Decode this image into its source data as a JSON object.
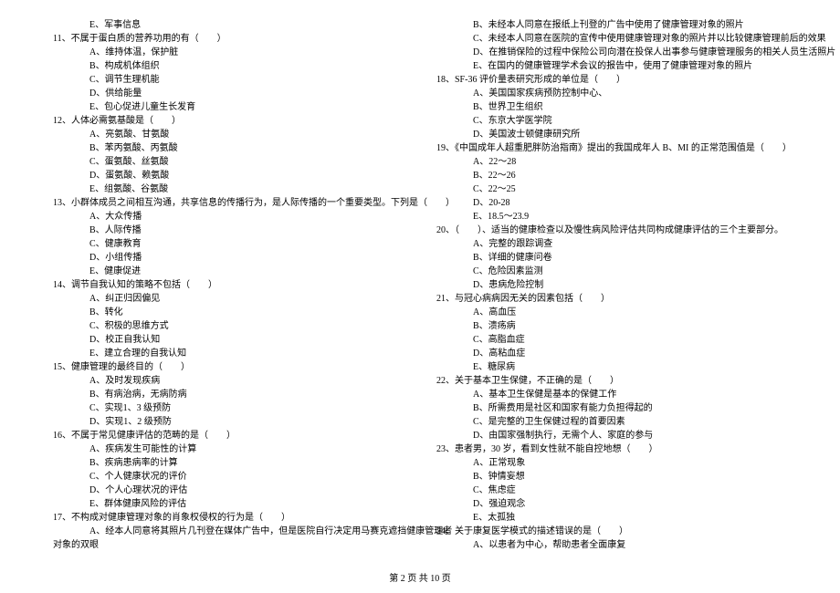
{
  "left": {
    "l1": "E、军事信息",
    "q11": "11、不属于蛋白质的营养功用的有（　　）",
    "q11a": "A、维持体温，保护脏",
    "q11b": "B、构成机体组织",
    "q11c": "C、调节生理机能",
    "q11d": "D、供给能量",
    "q11e": "E、包心促进儿童生长发育",
    "q12": "12、人体必需氨基酸是（　　）",
    "q12a": "A、亮氨酸、甘氨酸",
    "q12b": "B、苯丙氨酸、丙氨酸",
    "q12c": "C、蛋氨酸、丝氨酸",
    "q12d": "D、蛋氨酸、赖氨酸",
    "q12e": "E、组氨酸、谷氨酸",
    "q13": "13、小群体成员之间相互沟通，共享信息的传播行为，是人际传播的一个重要类型。下列是（　　）",
    "q13a": "A、大众传播",
    "q13b": "B、人际传播",
    "q13c": "C、健康教育",
    "q13d": "D、小组传播",
    "q13e": "E、健康促进",
    "q14": "14、调节自我认知的策略不包括（　　）",
    "q14a": "A、纠正归因偏见",
    "q14b": "B、转化",
    "q14c": "C、积极的思维方式",
    "q14d": "D、校正自我认知",
    "q14e": "E、建立合理的自我认知",
    "q15": "15、健康管理的最终目的（　　）",
    "q15a": "A、及时发现疾病",
    "q15b": "B、有病治病，无病防病",
    "q15c": "C、实现1、3 级预防",
    "q15d": "D、实现1、2 级预防",
    "q16": "16、不属于常见健康评估的范畴的是（　　）",
    "q16a": "A、疾病发生可能性的计算",
    "q16b": "B、疾病患病率的计算",
    "q16c": "C、个人健康状况的评价",
    "q16d": "D、个人心理状况的评估",
    "q16e": "E、群体健康风险的评估",
    "q17": "17、不构成对健康管理对象的肖象权侵权的行为是（　　）",
    "q17line1": "A、经本人同意将其照片几刊登在媒体广告中，但是医院自行决定用马赛克遮挡健康管理者",
    "q17line2": "对象的双眼"
  },
  "right": {
    "q17b": "B、未经本人同意在报纸上刊登的广告中使用了健康管理对象的照片",
    "q17c": "C、未经本人同意在医院的宣传中使用健康管理对象的照片并以比较健康管理前后的效果",
    "q17d": "D、在推销保险的过程中保险公司向潜在投保人出事参与健康管理服务的相关人员生活照片",
    "q17e": "E、在国内的健康管理学术会议的报告中，使用了健康管理对象的照片",
    "q18": "18、SF-36 评价量表研究形成的单位是（　　）",
    "q18a": "A、美国国家疾病预防控制中心、",
    "q18b": "B、世界卫生组织",
    "q18c": "C、东京大学医学院",
    "q18d": "D、美国波士顿健康研究所",
    "q19": "19、《中国成年人超重肥胖防治指南》提出的我国成年人 B、MI 的正常范围值是（　　）",
    "q19a": "A、22～28",
    "q19b": "B、22～26",
    "q19c": "C、22～25",
    "q19d": "D、20-28",
    "q19e": "E、18.5～23.9",
    "q20": "20、（　　）、适当的健康检查以及慢性病风险评估共同构成健康评估的三个主要部分。",
    "q20a": "A、完整的跟踪调查",
    "q20b": "B、详细的健康问卷",
    "q20c": "C、危险因素监测",
    "q20d": "D、患病危险控制",
    "q21": "21、与冠心病病因无关的因素包括（　　）",
    "q21a": "A、高血压",
    "q21b": "B、溃疡病",
    "q21c": "C、高脂血症",
    "q21d": "D、高粘血症",
    "q21e": "E、糖尿病",
    "q22": "22、关于基本卫生保健，不正确的是（　　）",
    "q22a": "A、基本卫生保健是基本的保健工作",
    "q22b": "B、所需费用是社区和国家有能力负担得起的",
    "q22c": "C、是完整的卫生保健过程的首要因素",
    "q22d": "D、由国家强制执行，无需个人、家庭的参与",
    "q23": "23、患者男，30 岁，看到女性就不能自控地想（　　）",
    "q23a": "A、正常现象",
    "q23b": "B、钟情妄想",
    "q23c": "C、焦虑症",
    "q23d": "D、强迫观念",
    "q23e": "E、太孤独",
    "q24": "24、关于康复医学模式的描述错误的是（　　）",
    "q24a": "A、以患者为中心，帮助患者全面康复"
  },
  "footer": "第 2 页 共 10 页"
}
